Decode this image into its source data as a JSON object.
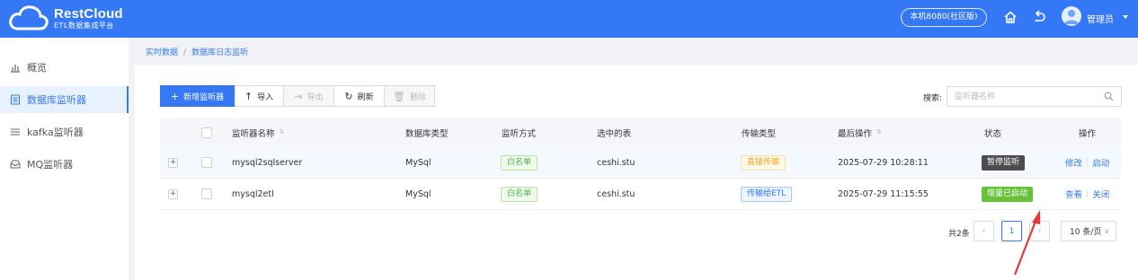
{
  "app": {
    "brand": "RestCloud",
    "subtitle": "ETL数据集成平台"
  },
  "header": {
    "environment": "本机8080(社区版)",
    "icons": [
      "home-icon",
      "back-icon"
    ],
    "user": "管理员"
  },
  "sidebar": {
    "items": [
      {
        "label": "概览",
        "icon": "chart-icon",
        "active": false
      },
      {
        "label": "数据库监听器",
        "icon": "database-list-icon",
        "active": true
      },
      {
        "label": "kafka监听器",
        "icon": "list-icon",
        "active": false
      },
      {
        "label": "MQ监听器",
        "icon": "inbox-icon",
        "active": false
      }
    ]
  },
  "breadcrumb": [
    "实时数据",
    "数据库日志监听"
  ],
  "toolbar": {
    "add": "新增监听器",
    "import": "导入",
    "export": "导出",
    "refresh": "刷新",
    "delete": "删除"
  },
  "search": {
    "label": "搜索:",
    "placeholder": "监听器名称"
  },
  "table": {
    "columns": [
      "监听器名称",
      "数据库类型",
      "监听方式",
      "选中的表",
      "传输类型",
      "最后操作",
      "状态",
      "操作"
    ],
    "rows": [
      {
        "name": "mysql2sqlserver",
        "db_type": "MySql",
        "mode": "白名单",
        "tables": "ceshi.stu",
        "transfer": "直接传输",
        "last_op": "2025-07-29 10:28:11",
        "status": "暂停监听",
        "actions": [
          "修改",
          "启动"
        ]
      },
      {
        "name": "mysql2etl",
        "db_type": "MySql",
        "mode": "白名单",
        "tables": "ceshi.stu",
        "transfer": "传输给ETL",
        "last_op": "2025-07-29 11:15:55",
        "status": "增量已启动",
        "actions": [
          "查看",
          "关闭"
        ]
      }
    ]
  },
  "pagination": {
    "total": "共2条",
    "current_page": "1",
    "page_size": "10 条/页"
  },
  "colors": {
    "primary": "#3478f6",
    "header_bg": "#3478f6",
    "annotation_arrow": "#e53935"
  }
}
